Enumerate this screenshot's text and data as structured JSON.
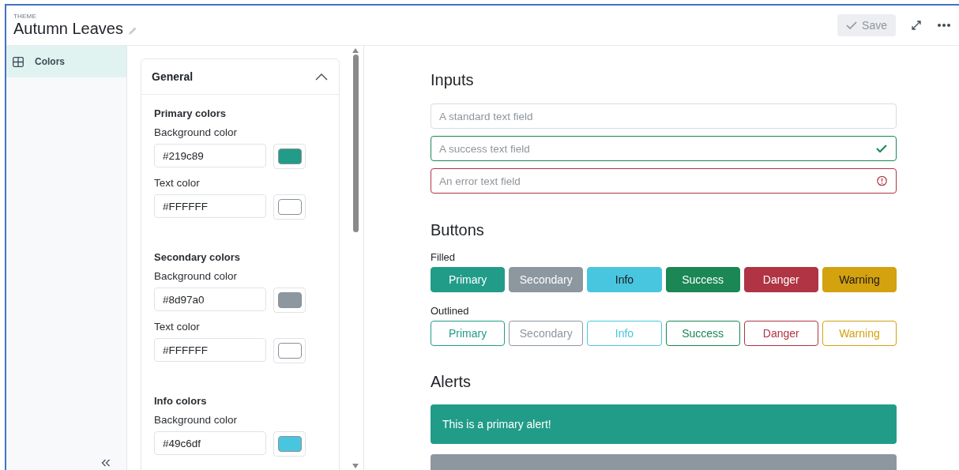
{
  "header": {
    "eyebrow": "THEME",
    "title": "Autumn Leaves",
    "save_button": {
      "label": "Save",
      "disabled": true
    }
  },
  "sidebar": {
    "items": [
      {
        "label": "Colors",
        "selected": true
      }
    ]
  },
  "settings": {
    "panel": {
      "title": "General",
      "expanded": true,
      "sections": [
        {
          "title": "Primary colors",
          "fields": [
            {
              "label": "Background color",
              "value": "#219c89"
            },
            {
              "label": "Text color",
              "value": "#FFFFFF"
            }
          ]
        },
        {
          "title": "Secondary colors",
          "fields": [
            {
              "label": "Background color",
              "value": "#8d97a0"
            },
            {
              "label": "Text color",
              "value": "#FFFFFF"
            }
          ]
        },
        {
          "title": "Info colors",
          "fields": [
            {
              "label": "Background color",
              "value": "#49c6df"
            }
          ]
        }
      ]
    }
  },
  "preview": {
    "inputs": {
      "title": "Inputs",
      "fields": [
        {
          "kind": "standard",
          "placeholder": "A standard text field"
        },
        {
          "kind": "success",
          "placeholder": "A success text field"
        },
        {
          "kind": "error",
          "placeholder": "An error text field"
        }
      ]
    },
    "buttons": {
      "title": "Buttons",
      "groups": [
        {
          "label": "Filled",
          "kind": "filled",
          "buttons": [
            {
              "label": "Primary",
              "color": "#219c89"
            },
            {
              "label": "Secondary",
              "color": "#8d97a0"
            },
            {
              "label": "Info",
              "color": "#49c6df"
            },
            {
              "label": "Success",
              "color": "#1a8754"
            },
            {
              "label": "Danger",
              "color": "#b03443"
            },
            {
              "label": "Warning",
              "color": "#d4a10f"
            }
          ]
        },
        {
          "label": "Outlined",
          "kind": "outlined",
          "buttons": [
            {
              "label": "Primary",
              "color": "#219c89"
            },
            {
              "label": "Secondary",
              "color": "#8d97a0"
            },
            {
              "label": "Info",
              "color": "#49c6df"
            },
            {
              "label": "Success",
              "color": "#1a8754"
            },
            {
              "label": "Danger",
              "color": "#b03443"
            },
            {
              "label": "Warning",
              "color": "#d4a10f"
            }
          ]
        }
      ]
    },
    "alerts": {
      "title": "Alerts",
      "items": [
        {
          "text": "This is a primary alert!",
          "color": "#219c89"
        },
        {
          "color": "#8d97a0"
        }
      ]
    }
  }
}
